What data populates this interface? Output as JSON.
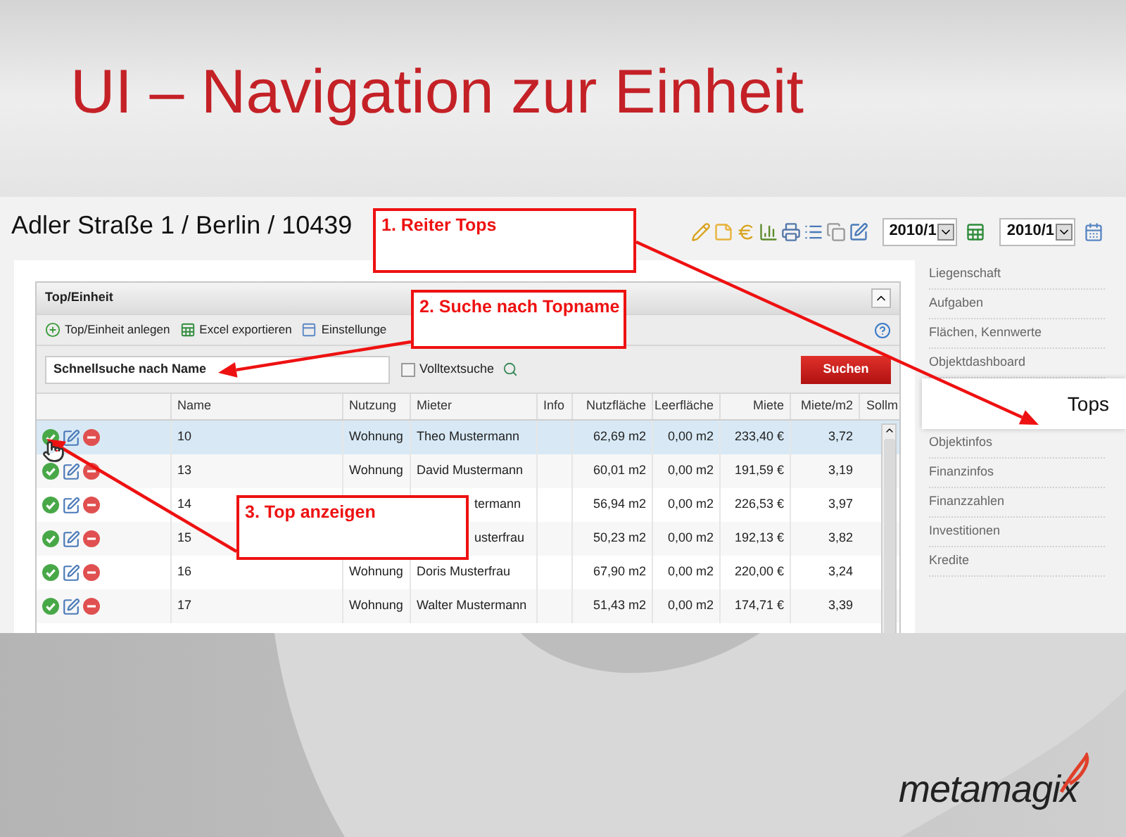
{
  "slide": {
    "title": "UI – Navigation zur Einheit",
    "logo": "metamagix"
  },
  "app": {
    "breadcrumb": "Adler Straße 1 / Berlin / 10439",
    "dates": [
      "2010/1",
      "2010/1"
    ],
    "panel": {
      "title": "Top/Einheit",
      "toolbar": [
        "Top/Einheit anlegen",
        "Excel exportieren",
        "Einstellunge"
      ],
      "search": {
        "value": "Schnellsuche nach Name",
        "fulltext_label": "Volltextsuche",
        "fulltext_checked": false,
        "button": "Suchen"
      },
      "table": {
        "columns": [
          "Name",
          "Nutzung",
          "Mieter",
          "Info",
          "Nutzfläche",
          "Leerfläche",
          "Miete",
          "Miete/m2",
          "Sollm"
        ],
        "rows": [
          {
            "selected": true,
            "covered": false,
            "cells": [
              "10",
              "Wohnung",
              "Theo Mustermann",
              null,
              "62,69 m2",
              "0,00 m2",
              "233,40 €",
              "3,72"
            ]
          },
          {
            "selected": false,
            "covered": false,
            "cells": [
              "13",
              "Wohnung",
              "David Mustermann",
              null,
              "60,01 m2",
              "0,00 m2",
              "191,59 €",
              "3,19"
            ]
          },
          {
            "selected": false,
            "covered": true,
            "cells": [
              "14",
              null,
              "termann",
              null,
              "56,94 m2",
              "0,00 m2",
              "226,53 €",
              "3,97"
            ]
          },
          {
            "selected": false,
            "covered": true,
            "cells": [
              "15",
              null,
              "usterfrau",
              null,
              "50,23 m2",
              "0,00 m2",
              "192,13 €",
              "3,82"
            ]
          },
          {
            "selected": false,
            "covered": false,
            "cells": [
              "16",
              "Wohnung",
              "Doris Musterfrau",
              null,
              "67,90 m2",
              "0,00 m2",
              "220,00 €",
              "3,24"
            ]
          },
          {
            "selected": false,
            "covered": false,
            "cells": [
              "17",
              "Wohnung",
              "Walter Mustermann",
              null,
              "51,43 m2",
              "0,00 m2",
              "174,71 €",
              "3,39"
            ]
          }
        ]
      }
    },
    "sidebar": [
      {
        "label": "Liegenschaft",
        "selected": false
      },
      {
        "label": "Aufgaben",
        "selected": false
      },
      {
        "label": "Flächen, Kennwerte",
        "selected": false
      },
      {
        "label": "Objektdashboard",
        "selected": false
      },
      {
        "label": "Tops",
        "selected": true
      },
      {
        "label": "Objektinfos",
        "selected": false
      },
      {
        "label": "Finanzinfos",
        "selected": false
      },
      {
        "label": "Finanzzahlen",
        "selected": false
      },
      {
        "label": "Investitionen",
        "selected": false
      },
      {
        "label": "Kredite",
        "selected": false
      }
    ]
  },
  "annotations": [
    {
      "text": "1. Reiter Tops"
    },
    {
      "text": "2. Suche nach Topname"
    },
    {
      "text": "3. Top anzeigen"
    }
  ]
}
